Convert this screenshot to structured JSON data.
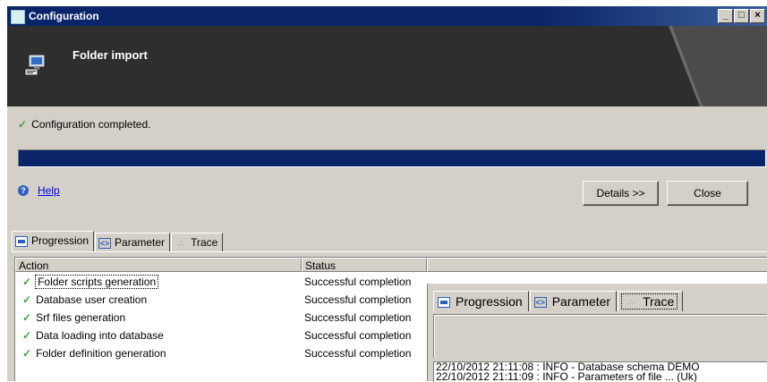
{
  "window": {
    "title": "Configuration",
    "controls": [
      "_",
      "□",
      "×"
    ]
  },
  "banner": {
    "title": "Folder import",
    "icon": "computer-setup-icon"
  },
  "status": {
    "icon": "check-icon",
    "text": "Configuration completed."
  },
  "progress": {
    "fraction": 1.0,
    "color": "#0a246a"
  },
  "help": {
    "icon": "help-icon",
    "label": "Help"
  },
  "buttons": {
    "details": "Details >>",
    "close": "Close"
  },
  "tabs": [
    {
      "label": "Progression",
      "icon": "progression-icon",
      "active": true
    },
    {
      "label": "Parameter",
      "icon": "parameter-icon",
      "active": false
    },
    {
      "label": "Trace",
      "icon": "trace-icon",
      "active": false
    }
  ],
  "grid": {
    "columns": [
      "Action",
      "Status"
    ],
    "rows": [
      {
        "action": "Folder scripts generation",
        "status": "Successful completion"
      },
      {
        "action": "Database user creation",
        "status": "Successful completion"
      },
      {
        "action": "Srf files generation",
        "status": "Successful completion"
      },
      {
        "action": "Data loading into database",
        "status": "Successful completion"
      },
      {
        "action": "Folder definition generation",
        "status": "Successful completion"
      }
    ]
  },
  "zoom_panel": {
    "tabs": [
      {
        "label": "Progression",
        "icon": "progression-icon"
      },
      {
        "label": "Parameter",
        "icon": "parameter-icon"
      },
      {
        "label": "Trace",
        "icon": "trace-icon",
        "active": true
      }
    ],
    "log_lines": [
      "22/10/2012 21:11:08 : INFO - Database schema DEMO",
      "22/10/2012 21:11:09 : INFO - Parameters of file ... (Uk)"
    ]
  }
}
